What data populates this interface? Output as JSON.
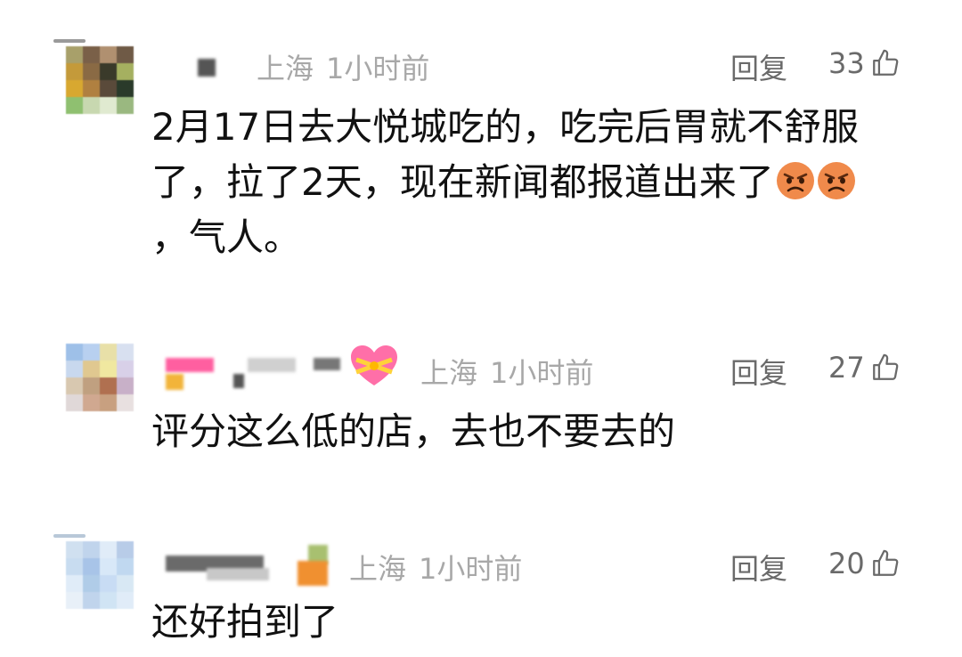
{
  "comments": [
    {
      "location": "上海",
      "time": "1小时前",
      "reply_label": "回复",
      "likes": "33",
      "text_lines": [
        "2月17日去大悦城吃的，吃完后胃就不舒服",
        "了，拉了2天，现在新闻都报道出来了",
        "，气人。"
      ],
      "emoji": "angry-face-icon"
    },
    {
      "location": "上海",
      "time": "1小时前",
      "reply_label": "回复",
      "likes": "27",
      "text_lines": [
        "评分这么低的店，去也不要去的"
      ],
      "badge": "heart-with-ribbon-icon"
    },
    {
      "location": "上海",
      "time": "1小时前",
      "reply_label": "回复",
      "likes": "20",
      "text_lines": [
        "还好拍到了"
      ]
    }
  ],
  "colors": {
    "meta": "#a8a8a8",
    "reply": "#6a6a6a",
    "text": "#111111",
    "emoji": "#f08a4b"
  }
}
